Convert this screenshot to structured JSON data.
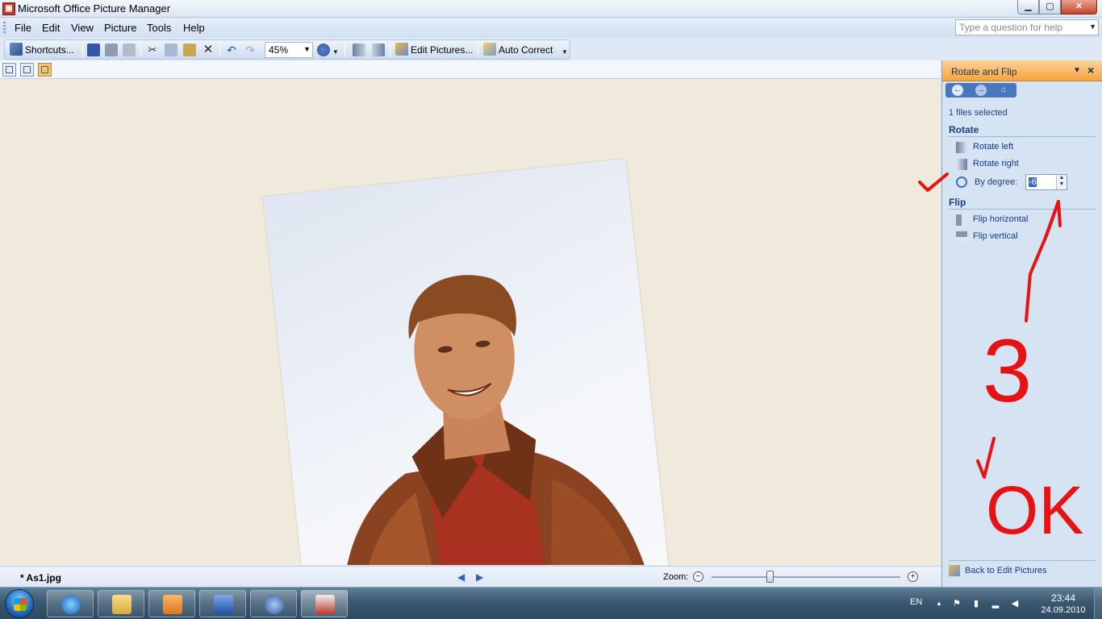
{
  "window": {
    "title": "Microsoft Office Picture Manager",
    "icon": "picture-manager-icon"
  },
  "window_buttons": {
    "minimize": "▁",
    "maximize": "▢",
    "close": "✕"
  },
  "menu": {
    "items": [
      "File",
      "Edit",
      "View",
      "Picture",
      "Tools",
      "Help"
    ]
  },
  "help_box": {
    "placeholder": "Type a question for help"
  },
  "toolbar": {
    "shortcuts_label": "Shortcuts...",
    "zoom_value": "45%",
    "edit_pictures_label": "Edit Pictures...",
    "auto_correct_label": "Auto Correct"
  },
  "status": {
    "filename": "* As1.jpg",
    "zoom_label": "Zoom:",
    "zoom_slider_level": 0.31
  },
  "task_pane": {
    "title": "Rotate and Flip",
    "files_selected": "1 files selected",
    "rotate_heading": "Rotate",
    "rotate_left": "Rotate left",
    "rotate_right": "Rotate right",
    "by_degree_label": "By degree:",
    "degree_value": "-6",
    "flip_heading": "Flip",
    "flip_horizontal": "Flip horizontal",
    "flip_vertical": "Flip vertical",
    "back_link": "Back to Edit Pictures"
  },
  "annotation": {
    "text_number": "3",
    "text_ok": "OK",
    "color": "#e81212"
  },
  "taskbar": {
    "apps": [
      "internet-explorer-icon",
      "windows-explorer-icon",
      "media-player-icon",
      "word-icon",
      "thunderbird-icon",
      "picture-manager-icon"
    ],
    "language": "EN",
    "time": "23:44",
    "date": "24.09.2010"
  },
  "colors": {
    "accent_orange": "#f6a43c",
    "pane_blue": "#d6e3f3",
    "canvas": "#efeadb"
  }
}
